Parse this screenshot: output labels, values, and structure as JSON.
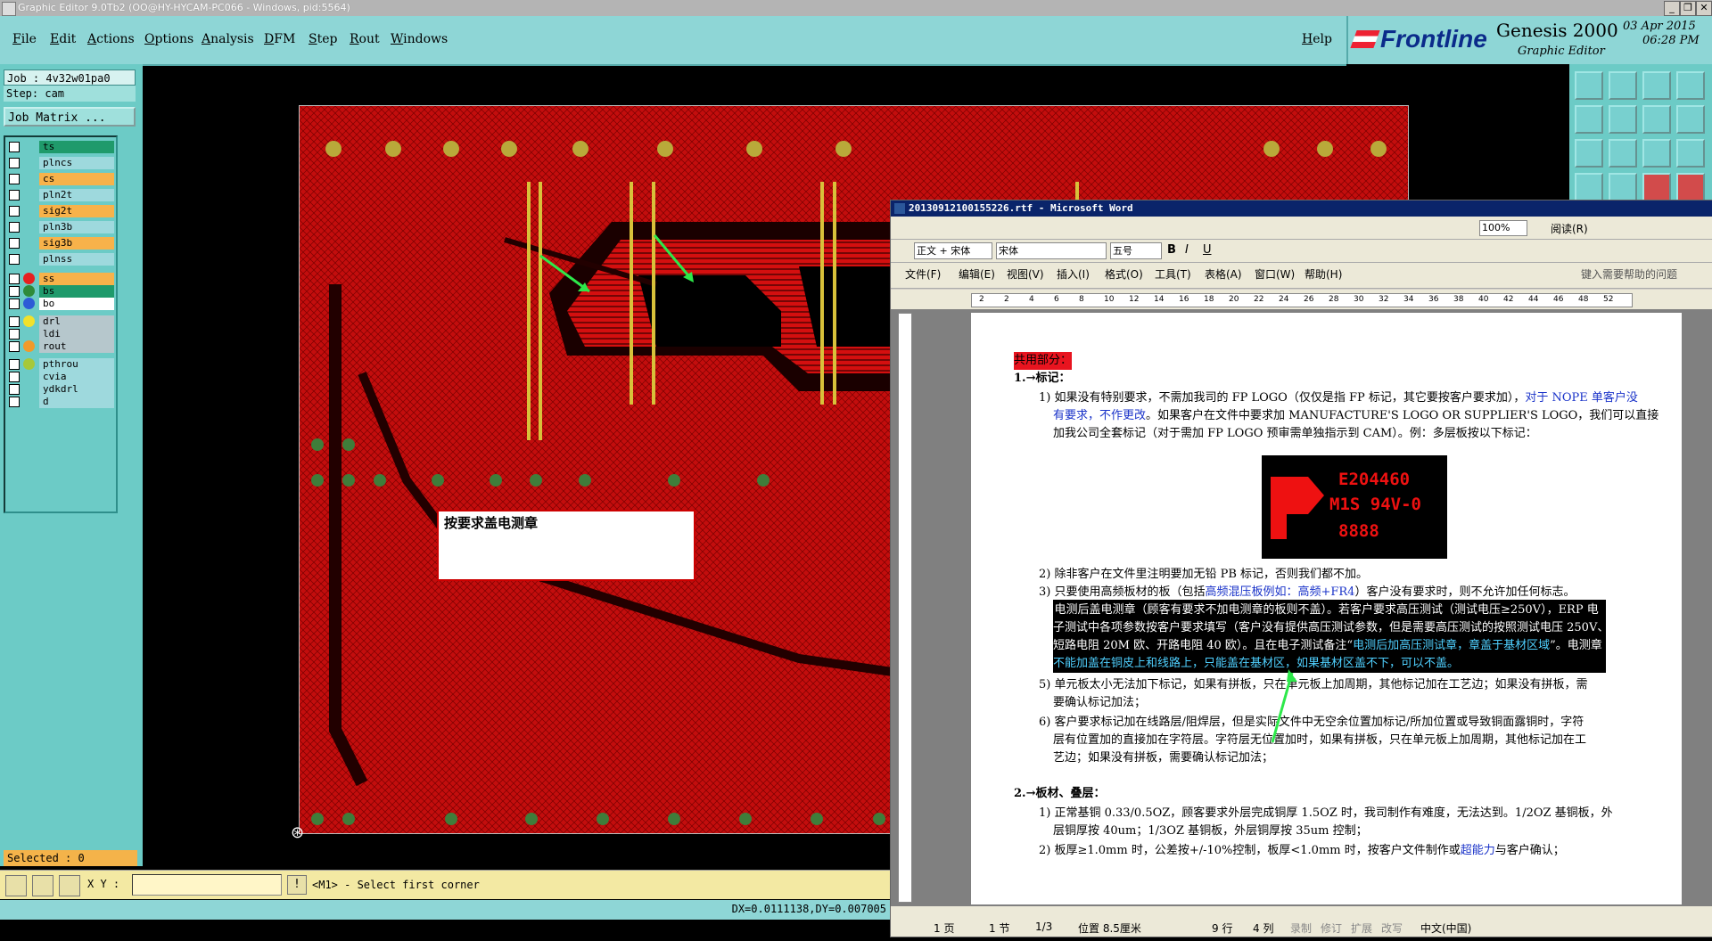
{
  "genesis": {
    "title_bar": "Graphic Editor 9.0Tb2 (OO@HY-HYCAM-PC066 - Windows, pid:5564)",
    "menu": [
      "File",
      "Edit",
      "Actions",
      "Options",
      "Analysis",
      "DFM",
      "Step",
      "Rout",
      "Windows"
    ],
    "help": "Help",
    "brand": {
      "logo": "Frontline",
      "product": "Genesis 2000",
      "subtitle": "Graphic Editor",
      "date": "03 Apr 2015",
      "time": "06:28 PM"
    },
    "job": "Job : 4v32w01pa0",
    "step": "Step: cam",
    "job_matrix": "Job Matrix ...",
    "layers": [
      {
        "name": "ts",
        "color": "#1f9a6b",
        "dot": ""
      },
      {
        "name": "plncs",
        "color": "#9ed9dd",
        "dot": ""
      },
      {
        "name": "cs",
        "color": "#f7b24a",
        "dot": ""
      },
      {
        "name": "pln2t",
        "color": "#9ed9dd",
        "dot": ""
      },
      {
        "name": "sig2t",
        "color": "#f7b24a",
        "dot": ""
      },
      {
        "name": "pln3b",
        "color": "#9ed9dd",
        "dot": ""
      },
      {
        "name": "sig3b",
        "color": "#f7b24a",
        "dot": ""
      },
      {
        "name": "plnss",
        "color": "#9ed9dd",
        "dot": ""
      },
      {
        "name": "ss",
        "color": "#f7b24a",
        "dot": "#e62020"
      },
      {
        "name": "bs",
        "color": "#1f9a6b",
        "dot": "#2e8b3a"
      },
      {
        "name": "bo",
        "color": "#ffffff",
        "dot": "#2d5bd6"
      },
      {
        "name": "drl",
        "color": "#b6c7cc",
        "dot": "#f1e12a"
      },
      {
        "name": "ldi",
        "color": "#b6c7cc",
        "dot": ""
      },
      {
        "name": "rout",
        "color": "#b6c7cc",
        "dot": "#f19a2a"
      },
      {
        "name": "pthrou",
        "color": "#9ed9dd",
        "dot": "#a6c83a"
      },
      {
        "name": "cvia",
        "color": "#9ed9dd",
        "dot": ""
      },
      {
        "name": "ydkdrl",
        "color": "#9ed9dd",
        "dot": ""
      },
      {
        "name": "d",
        "color": "#9ed9dd",
        "dot": ""
      }
    ],
    "selected": "Selected : 0",
    "xy_label": "X Y :",
    "prompt": "<M1> - Select first corner",
    "coords": "DX=0.0111138,DY=0.007005"
  },
  "board_text": "按要求盖电测章",
  "word": {
    "title": "20130912100155226.rtf - Microsoft Word",
    "zoom": "100%",
    "reading": "阅读(R)",
    "style": "正文 + 宋体",
    "font": "宋体",
    "size": "五号",
    "menu": [
      "文件(F)",
      "编辑(E)",
      "视图(V)",
      "插入(I)",
      "格式(O)",
      "工具(T)",
      "表格(A)",
      "窗口(W)",
      "帮助(H)"
    ],
    "help_prompt": "键入需要帮助的问题",
    "ruler": [
      "2",
      "2",
      "4",
      "6",
      "8",
      "10",
      "12",
      "14",
      "16",
      "18",
      "20",
      "22",
      "24",
      "26",
      "28",
      "30",
      "32",
      "34",
      "36",
      "38",
      "40",
      "42",
      "44",
      "46",
      "48",
      "52"
    ],
    "heading_common": "共用部分：",
    "h1": "1.→标记：",
    "p1a": "1) 如果没有特别要求，不需加我司的 FP LOGO（仅仅是指 FP 标记，其它要按客户要求加），",
    "p1a_blue": "对于 NOPE 单客户没",
    "p1b_blue": "有要求，不作更改",
    "p1b": "。如果客户在文件中要求加 MANUFACTURE'S LOGO OR SUPPLIER'S LOGO，我们可以直接",
    "p1c": "加我公司全套标记（对于需加 FP LOGO 预审需单独指示到 CAM）。例：多层板按以下标记：",
    "logo_code": "E204460",
    "logo_rating": "M1S 94V-0",
    "logo_digits": "8888",
    "p2": "2) 除非客户在文件里注明要加无铅 PB 标记，否则我们都不加。",
    "p3a": "3) 只要使用高频板材的板（包括",
    "p3_blue": "高频混压板例如：高频+FR4",
    "p3b": "）客户没有要求时，则不允许加任何标志。",
    "p4a": "4) 电测后盖电测章（顾客有要求不加电测章的板则不盖）。若客户要求高压测试（测试电压≥250V），ERP 电",
    "p4b": "子测试中各项参数按客户要求填写（客户没有提供高压测试参数，但是需要高压测试的按照测试电压 250V、",
    "p4c": "短路电阻 20M 欧、开路电阻 40 欧）。且在电子测试备注“",
    "p4c_blue": "电测后加高压测试章，章盖于基材区域",
    "p4c_end": "”。电测章",
    "p4d": "不能加盖在铜皮上和线路上，只能盖在基材区，如果基材区盖不下，可以不盖。",
    "p5a": "5) 单元板太小无法加下标记，如果有拼板，只在单元板上加周期，其他标记加在工艺边；如果没有拼板，需",
    "p5b": "要确认标记加法；",
    "p6a": "6) 客户要求标记加在线路层/阻焊层，但是实际文件中无空余位置加标记/所加位置或导致铜面露铜时，字符",
    "p6b": "层有位置加的直接加在字符层。字符层无位置加时，如果有拼板，只在单元板上加周期，其他标记加在工",
    "p6c": "艺边；如果没有拼板，需要确认标记加法；",
    "h2": "2.→板材、叠层：",
    "q1a": "1) 正常基铜 0.33/0.5OZ，顾客要求外层完成铜厚 1.5OZ 时，我司制作有难度，无法达到。1/2OZ 基铜板，外",
    "q1b": "层铜厚按 40um；1/3OZ 基铜板，外层铜厚按 35um 控制；",
    "q2a": "2) 板厚≥1.0mm 时，公差按+/-10%控制，板厚<1.0mm 时，按客户文件制作或",
    "q2_blue": "超能力",
    "q2b": "与客户确认；",
    "status": {
      "page": "1 页",
      "section": "1 节",
      "pages": "1/3",
      "pos": "位置 8.5厘米",
      "line": "9 行",
      "col": "4 列",
      "rec": "录制",
      "trk": "修订",
      "ext": "扩展",
      "ovr": "改写",
      "lang": "中文(中国)"
    }
  }
}
